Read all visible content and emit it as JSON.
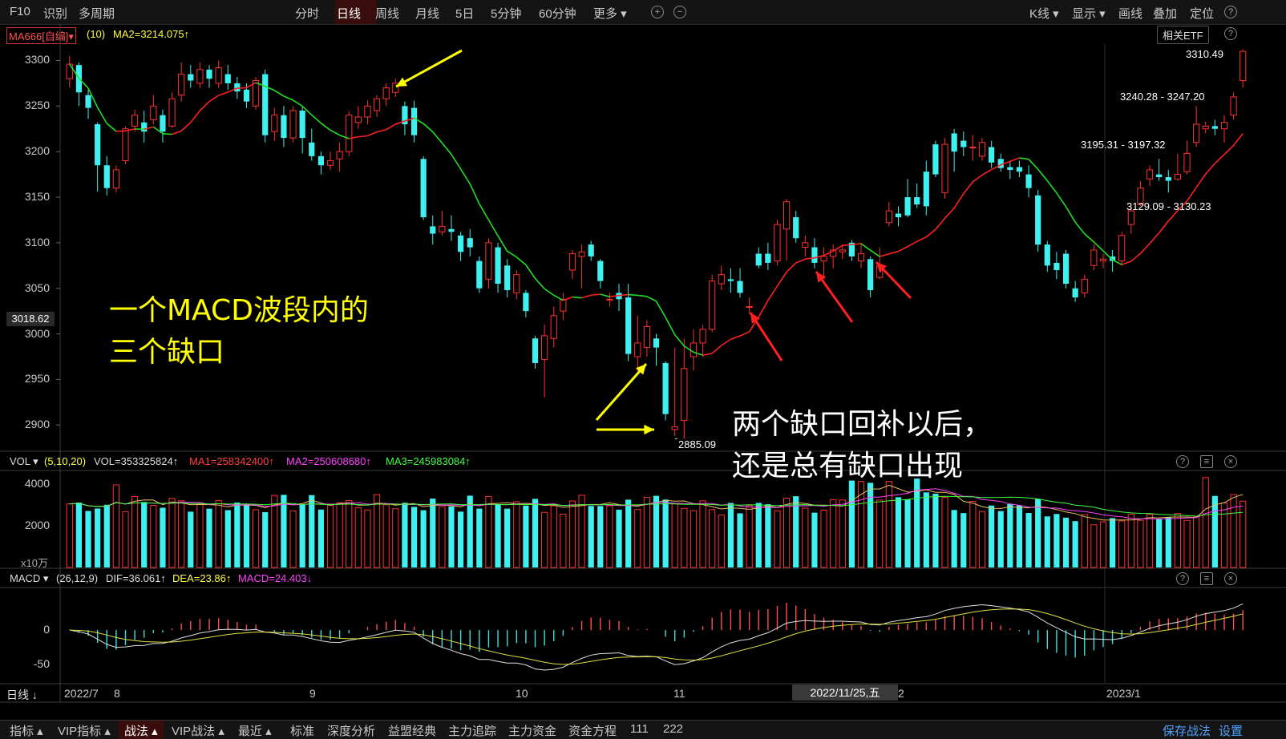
{
  "topbar": {
    "left": [
      "F10",
      "识别",
      "多周期"
    ],
    "periods": [
      "分时",
      "日线",
      "周线",
      "月线",
      "5日",
      "5分钟",
      "60分钟",
      "更多 ▾"
    ],
    "right": [
      "K线 ▾",
      "显示 ▾",
      "画线",
      "叠加",
      "定位"
    ]
  },
  "main": {
    "indicator_name": "MA666[自编]▾",
    "indicator_param": "(10)",
    "indicator_value": "MA2=3214.075↑",
    "etf_button": "相关ETF",
    "y_ticks": [
      "3300",
      "3250",
      "3200",
      "3150",
      "3100",
      "3050",
      "3000",
      "2950",
      "2900"
    ],
    "current_price": "3018.62",
    "labels": {
      "high": "3310.49",
      "range1": "3240.28 - 3247.20",
      "range2": "3195.31 - 3197.32",
      "range3": "3129.09 - 3130.23",
      "low": "2885.09"
    },
    "annotation1": [
      "一个MACD波段内的",
      "三个缺口"
    ],
    "annotation2": [
      "两个缺口回补以后，",
      "还是总有缺口出现"
    ]
  },
  "vol": {
    "name": "VOL ▾",
    "params": "(5,10,20)",
    "values": [
      {
        "text": "VOL=353325824↑",
        "color": "#d8d8d8"
      },
      {
        "text": "MA1=258342400↑",
        "color": "#ff4040"
      },
      {
        "text": "MA2=250608680↑",
        "color": "#ff40ff"
      },
      {
        "text": "MA3=245983084↑",
        "color": "#40ff40"
      }
    ],
    "y_ticks": [
      "4000",
      "2000"
    ],
    "unit": "x10万"
  },
  "macd": {
    "name": "MACD ▾",
    "params": "(26,12,9)",
    "values": [
      {
        "text": "DIF=36.061↑",
        "color": "#d8d8d8"
      },
      {
        "text": "DEA=23.86↑",
        "color": "#ffff40"
      },
      {
        "text": "MACD=24.403↓",
        "color": "#ff40ff"
      }
    ],
    "y_ticks": [
      "0",
      "-50"
    ]
  },
  "xaxis": {
    "period": "日线 ↓",
    "labels": [
      "2022/7",
      "8",
      "9",
      "10",
      "11",
      "2",
      "2023/1"
    ],
    "cursor_date": "2022/11/25,五"
  },
  "bottombar": {
    "items": [
      "指标 ▴",
      "VIP指标 ▴",
      "战法 ▴",
      "VIP战法 ▴",
      "最近 ▴",
      "标准",
      "深度分析",
      "益盟经典",
      "主力追踪",
      "主力资金",
      "资金方程",
      "111",
      "222"
    ],
    "right": [
      "保存战法",
      "设置"
    ]
  },
  "colors": {
    "up": "#ff3030",
    "down": "#3ff0f0",
    "annotation": "#ffff00",
    "ma_up": "#ff2020",
    "ma_down": "#20e020"
  },
  "chart_data": {
    "type": "candlestick",
    "note_free": true,
    "candles": [
      [
        3280,
        3296,
        3276,
        3305,
        3270
      ],
      [
        3295,
        3265,
        3258,
        3298,
        3250
      ],
      [
        3262,
        3248,
        3246,
        3268,
        3236
      ],
      [
        3230,
        3185,
        3158,
        3232,
        3156
      ],
      [
        3185,
        3160,
        3160,
        3195,
        3152
      ],
      [
        3160,
        3180,
        3180,
        3185,
        3155
      ],
      [
        3190,
        3225,
        3225,
        3228,
        3186
      ],
      [
        3228,
        3240,
        3240,
        3246,
        3222
      ],
      [
        3232,
        3222,
        3222,
        3245,
        3210
      ],
      [
        3235,
        3250,
        3250,
        3262,
        3230
      ],
      [
        3240,
        3222,
        3222,
        3246,
        3210
      ],
      [
        3228,
        3258,
        3258,
        3265,
        3226
      ],
      [
        3262,
        3285,
        3285,
        3298,
        3255
      ],
      [
        3285,
        3278,
        3278,
        3295,
        3270
      ],
      [
        3275,
        3290,
        3288,
        3298,
        3270
      ],
      [
        3290,
        3280,
        3280,
        3295,
        3270
      ],
      [
        3275,
        3292,
        3292,
        3300,
        3270
      ],
      [
        3285,
        3275,
        3275,
        3295,
        3268
      ],
      [
        3275,
        3266,
        3266,
        3282,
        3258
      ],
      [
        3268,
        3255,
        3255,
        3275,
        3248
      ],
      [
        3250,
        3278,
        3278,
        3282,
        3246
      ],
      [
        3285,
        3218,
        3218,
        3290,
        3210
      ],
      [
        3222,
        3240,
        3240,
        3248,
        3212
      ],
      [
        3240,
        3215,
        3215,
        3250,
        3205
      ],
      [
        3215,
        3245,
        3245,
        3250,
        3210
      ],
      [
        3245,
        3215,
        3215,
        3250,
        3198
      ],
      [
        3210,
        3195,
        3195,
        3225,
        3190
      ],
      [
        3195,
        3185,
        3185,
        3200,
        3175
      ],
      [
        3185,
        3190,
        3190,
        3200,
        3180
      ],
      [
        3192,
        3200,
        3200,
        3210,
        3178
      ],
      [
        3200,
        3240,
        3240,
        3244,
        3195
      ],
      [
        3232,
        3238,
        3238,
        3250,
        3225
      ],
      [
        3238,
        3250,
        3250,
        3256,
        3230
      ],
      [
        3245,
        3258,
        3258,
        3262,
        3238
      ],
      [
        3258,
        3270,
        3270,
        3275,
        3250
      ],
      [
        3265,
        3275,
        3275,
        3280,
        3260
      ],
      [
        3250,
        3230,
        3230,
        3255,
        3218
      ],
      [
        3248,
        3218,
        3218,
        3256,
        3210
      ],
      [
        3192,
        3128,
        3128,
        3195,
        3125
      ],
      [
        3118,
        3110,
        3110,
        3130,
        3098
      ],
      [
        3112,
        3118,
        3118,
        3135,
        3108
      ],
      [
        3115,
        3112,
        3112,
        3130,
        3102
      ],
      [
        3108,
        3090,
        3090,
        3112,
        3080
      ],
      [
        3105,
        3095,
        3095,
        3115,
        3085
      ],
      [
        3080,
        3050,
        3050,
        3085,
        3045
      ],
      [
        3060,
        3100,
        3100,
        3105,
        3050
      ],
      [
        3095,
        3055,
        3055,
        3100,
        3045
      ],
      [
        3075,
        3048,
        3048,
        3082,
        3040
      ],
      [
        3045,
        3065,
        3065,
        3070,
        3038
      ],
      [
        3045,
        3025,
        3025,
        3048,
        3018
      ],
      [
        2995,
        2968,
        2968,
        2998,
        2962
      ],
      [
        2972,
        2998,
        2998,
        3010,
        2930
      ],
      [
        2995,
        3020,
        3020,
        3030,
        2985
      ],
      [
        3025,
        3038,
        3038,
        3045,
        3015
      ],
      [
        3070,
        3088,
        3088,
        3092,
        3060
      ],
      [
        3085,
        3090,
        3090,
        3098,
        3050
      ],
      [
        3098,
        3085,
        3085,
        3102,
        3080
      ],
      [
        3080,
        3058,
        3058,
        3082,
        3050
      ],
      [
        3038,
        3038,
        3038,
        3045,
        3030
      ],
      [
        3045,
        3038,
        3038,
        3055,
        3025
      ],
      [
        3040,
        2978,
        2978,
        3055,
        2970
      ],
      [
        2975,
        2990,
        2990,
        3020,
        2958
      ],
      [
        2985,
        3008,
        3008,
        3015,
        2975
      ],
      [
        2995,
        2985,
        2985,
        3000,
        2965
      ],
      [
        2968,
        2912,
        2912,
        2970,
        2905
      ],
      [
        2895,
        2898,
        2898,
        2985,
        2888
      ],
      [
        2905,
        2962,
        2962,
        2995,
        2885
      ],
      [
        2975,
        2990,
        2990,
        3005,
        2960
      ],
      [
        2990,
        3005,
        3005,
        3010,
        2975
      ],
      [
        3005,
        3058,
        3058,
        3065,
        3002
      ],
      [
        3055,
        3065,
        3065,
        3075,
        3048
      ],
      [
        3060,
        3058,
        3058,
        3072,
        3045
      ],
      [
        3058,
        3045,
        3045,
        3072,
        3040
      ],
      [
        3030,
        3030,
        3030,
        3040,
        3022
      ],
      [
        3088,
        3075,
        3075,
        3095,
        3072
      ],
      [
        3088,
        3078,
        3078,
        3100,
        3070
      ],
      [
        3080,
        3120,
        3120,
        3125,
        3075
      ],
      [
        3115,
        3145,
        3145,
        3148,
        3080
      ],
      [
        3128,
        3105,
        3105,
        3135,
        3100
      ],
      [
        3095,
        3100,
        3100,
        3108,
        3085
      ],
      [
        3095,
        3078,
        3078,
        3105,
        3072
      ],
      [
        3080,
        3085,
        3085,
        3095,
        3062
      ],
      [
        3085,
        3092,
        3092,
        3098,
        3072
      ],
      [
        3090,
        3092,
        3092,
        3098,
        3082
      ],
      [
        3100,
        3085,
        3085,
        3103,
        3080
      ],
      [
        3080,
        3088,
        3088,
        3100,
        3072
      ],
      [
        3082,
        3048,
        3048,
        3085,
        3040
      ],
      [
        3062,
        3075,
        3075,
        3095,
        3060
      ],
      [
        3122,
        3135,
        3135,
        3145,
        3118
      ],
      [
        3132,
        3128,
        3128,
        3140,
        3118
      ],
      [
        3150,
        3130,
        3130,
        3170,
        3128
      ],
      [
        3150,
        3142,
        3142,
        3165,
        3138
      ],
      [
        3178,
        3140,
        3140,
        3190,
        3130
      ],
      [
        3208,
        3175,
        3175,
        3212,
        3172
      ],
      [
        3155,
        3208,
        3208,
        3215,
        3148
      ],
      [
        3220,
        3200,
        3200,
        3225,
        3178
      ],
      [
        3212,
        3205,
        3205,
        3222,
        3195
      ],
      [
        3205,
        3205,
        3205,
        3218,
        3190
      ],
      [
        3195,
        3210,
        3210,
        3215,
        3190
      ],
      [
        3205,
        3188,
        3188,
        3212,
        3182
      ],
      [
        3192,
        3182,
        3182,
        3198,
        3178
      ],
      [
        3183,
        3180,
        3180,
        3190,
        3170
      ],
      [
        3183,
        3178,
        3178,
        3190,
        3172
      ],
      [
        3175,
        3160,
        3160,
        3185,
        3150
      ],
      [
        3152,
        3098,
        3098,
        3158,
        3090
      ],
      [
        3098,
        3075,
        3075,
        3102,
        3068
      ],
      [
        3078,
        3070,
        3070,
        3090,
        3060
      ],
      [
        3088,
        3055,
        3055,
        3092,
        3050
      ],
      [
        3050,
        3040,
        3040,
        3058,
        3035
      ],
      [
        3045,
        3060,
        3060,
        3065,
        3040
      ],
      [
        3075,
        3092,
        3092,
        3098,
        3070
      ],
      [
        3080,
        3082,
        3082,
        3088,
        3072
      ],
      [
        3085,
        3080,
        3080,
        3092,
        3068
      ],
      [
        3080,
        3108,
        3108,
        3112,
        3075
      ],
      [
        3120,
        3135,
        3135,
        3140,
        3110
      ],
      [
        3142,
        3160,
        3160,
        3168,
        3140
      ],
      [
        3170,
        3180,
        3180,
        3185,
        3162
      ],
      [
        3175,
        3172,
        3172,
        3192,
        3168
      ],
      [
        3172,
        3168,
        3168,
        3180,
        3155
      ],
      [
        3170,
        3175,
        3175,
        3198,
        3168
      ],
      [
        3178,
        3198,
        3198,
        3212,
        3175
      ],
      [
        3210,
        3230,
        3230,
        3250,
        3205
      ],
      [
        3225,
        3228,
        3228,
        3233,
        3220
      ],
      [
        3228,
        3225,
        3225,
        3235,
        3218
      ],
      [
        3225,
        3232,
        3232,
        3240,
        3210
      ],
      [
        3240,
        3260,
        3260,
        3265,
        3235
      ],
      [
        3278,
        3310,
        3310,
        3312,
        3270
      ]
    ]
  }
}
